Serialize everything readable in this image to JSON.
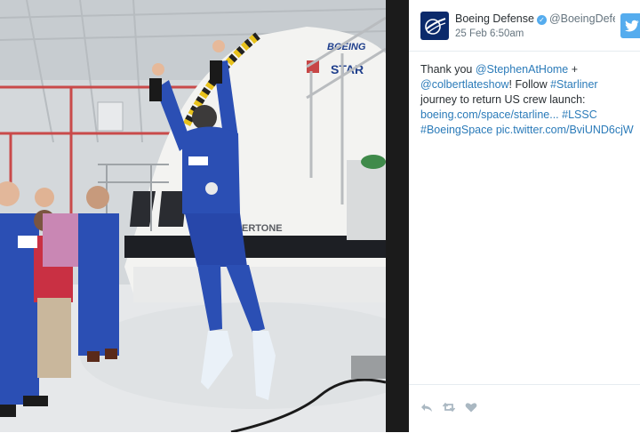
{
  "photo": {
    "capsule_logo": "BOEING",
    "capsule_name": "STAR",
    "capsule_band": "ERTONE"
  },
  "tweet": {
    "display_name": "Boeing Defense",
    "handle": "@BoeingDefe...",
    "timestamp": "25 Feb 6:50am",
    "text_parts": [
      "Thank you ",
      "@StephenAtHome",
      " + ",
      "@colbertlateshow",
      "! Follow ",
      "#Starliner",
      " journey to return US crew launch: ",
      "boeing.com/space/starline...",
      " ",
      "#LSSC",
      " ",
      "#BoeingSpace",
      " ",
      "pic.twitter.com/BviUND6cjW"
    ],
    "link_color": "#2b7bb9"
  },
  "icons": {
    "verified": "verified-badge-icon",
    "twitter": "twitter-bird-icon",
    "reply": "reply-icon",
    "retweet": "retweet-icon",
    "like": "heart-icon"
  },
  "colors": {
    "twitter_blue": "#55acee",
    "boeing_navy": "#0b2a6b",
    "divider": "#1b1b1b"
  }
}
